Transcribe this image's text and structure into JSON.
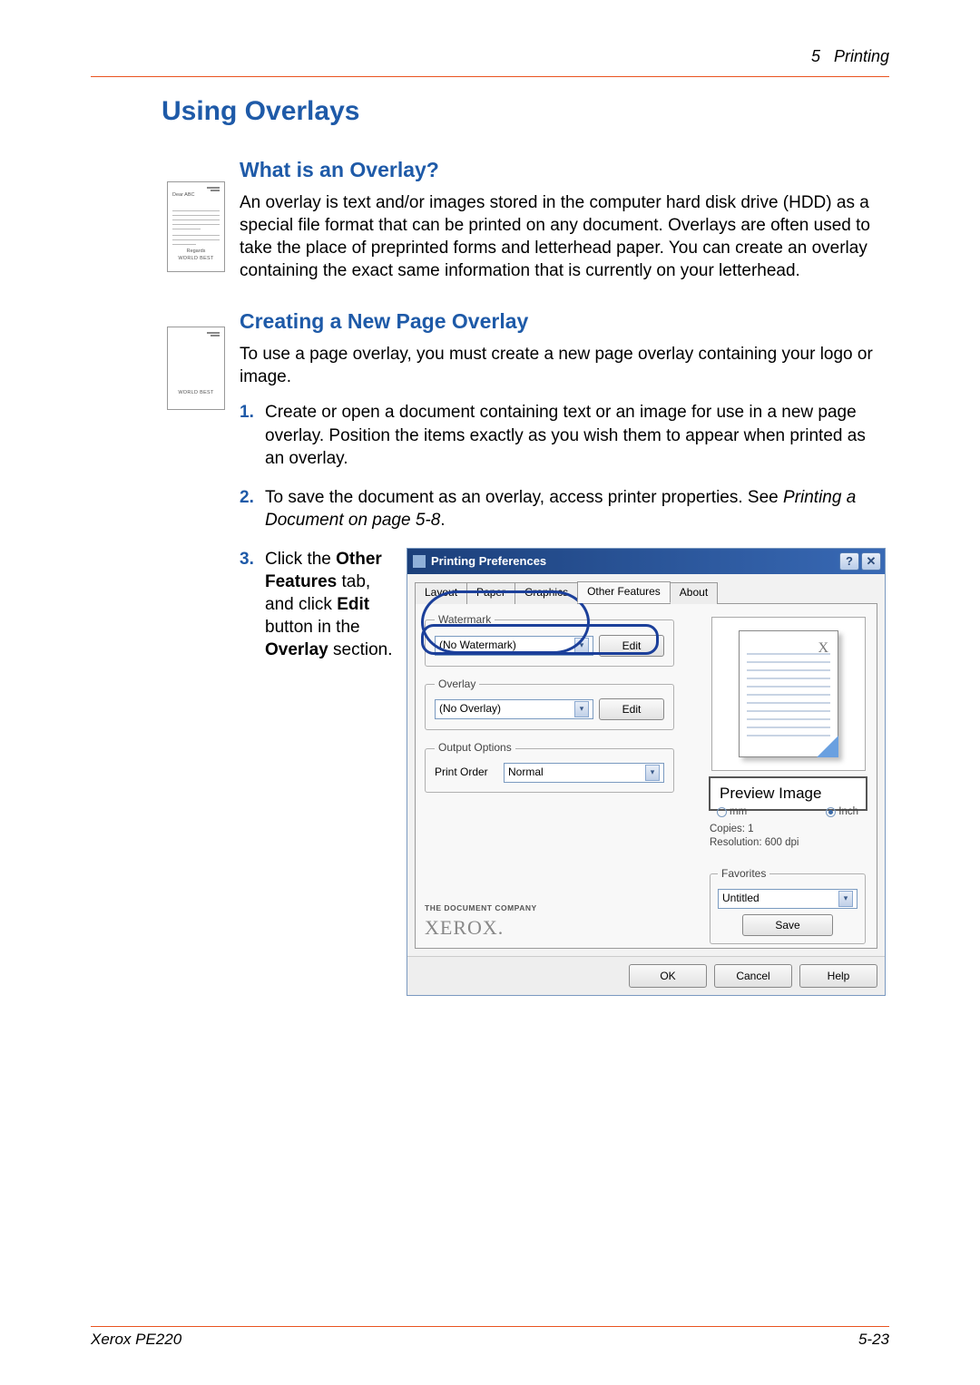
{
  "header": {
    "chapter": "5",
    "section": "Printing"
  },
  "title": "Using Overlays",
  "s1": {
    "heading": "What is an Overlay?",
    "para": "An overlay is text and/or images stored in the computer hard disk drive (HDD) as a special file format that can be printed on any document. Overlays are often used to take the place of preprinted forms and letterhead paper. You can create an overlay containing the exact same information that is currently on your letterhead."
  },
  "s2": {
    "heading": "Creating a New Page Overlay",
    "intro": "To use a page overlay, you must create a new page overlay containing your logo or image.",
    "steps": {
      "n1": "1.",
      "t1": "Create or open a document containing text or an image for use in a new page overlay. Position the items exactly as you wish them to appear when printed as an overlay.",
      "n2": "2.",
      "t2a": "To save the document as an overlay, access printer properties. See ",
      "t2b": "Printing a Document on page 5-8",
      "t2c": ".",
      "n3": "3.",
      "t3a": "Click the ",
      "t3b": "Other Features",
      "t3c": " tab, and click ",
      "t3d": "Edit",
      "t3e": " button in the ",
      "t3f": "Overlay",
      "t3g": " section."
    }
  },
  "icons": {
    "addr": "Dear ABC",
    "reg": "Regards",
    "wb": "WORLD BEST"
  },
  "dialog": {
    "title": "Printing Preferences",
    "tabs": {
      "layout": "Layout",
      "paper": "Paper",
      "graphics": "Graphics",
      "other": "Other Features",
      "about": "About"
    },
    "groups": {
      "watermark": {
        "legend": "Watermark",
        "value": "(No Watermark)",
        "edit": "Edit"
      },
      "overlay": {
        "legend": "Overlay",
        "value": "(No Overlay)",
        "edit": "Edit"
      },
      "output": {
        "legend": "Output Options",
        "label": "Print Order",
        "value": "Normal"
      }
    },
    "preview_label": "Preview Image",
    "preview_x": "X",
    "info": {
      "unit_mm": "mm",
      "unit_in": "Inch",
      "copies": "Copies: 1",
      "res": "Resolution: 600 dpi"
    },
    "fav": {
      "legend": "Favorites",
      "value": "Untitled",
      "save": "Save"
    },
    "brand_sm": "THE DOCUMENT COMPANY",
    "brand_lg": "XEROX.",
    "buttons": {
      "ok": "OK",
      "cancel": "Cancel",
      "help": "Help"
    }
  },
  "footer": {
    "left": "Xerox PE220",
    "right": "5-23"
  }
}
